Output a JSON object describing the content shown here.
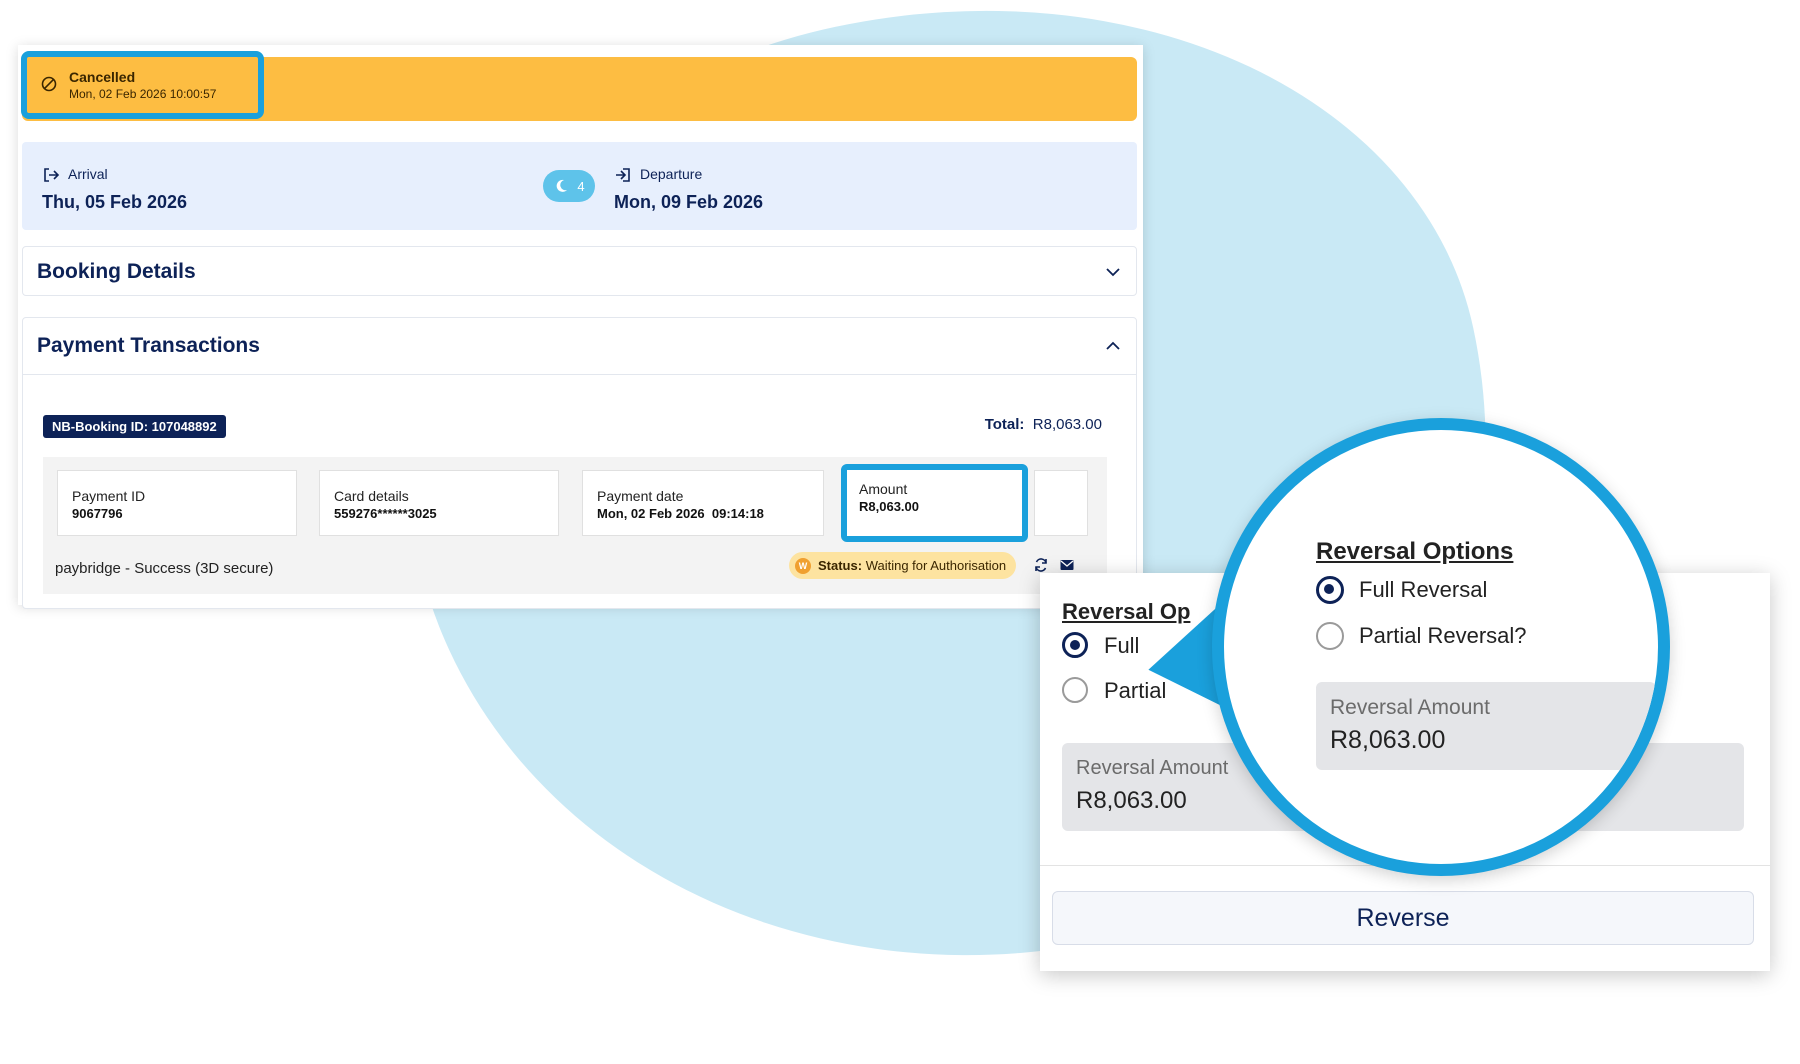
{
  "booking_status": {
    "label": "Cancelled",
    "timestamp": "Mon, 02 Feb 2026 10:00:57",
    "icon": "cancel-circle-icon"
  },
  "stay": {
    "arrival_label": "Arrival",
    "arrival_date": "Thu, 05 Feb 2026",
    "nights": "4",
    "departure_label": "Departure",
    "departure_date": "Mon, 09 Feb 2026"
  },
  "sections": {
    "booking_details": "Booking Details",
    "payment_transactions": "Payment Transactions"
  },
  "payment": {
    "booking_id_badge": "NB-Booking ID: 107048892",
    "total_label": "Total:",
    "total_value": "R8,063.00",
    "fields": [
      {
        "label": "Payment ID",
        "value": "9067796"
      },
      {
        "label": "Card details",
        "value": "559276******3025"
      },
      {
        "label": "Payment date",
        "value": "Mon, 02 Feb 2026  09:14:18"
      },
      {
        "label": "Amount",
        "value": "R8,063.00"
      }
    ],
    "gateway": "paybridge - Success (3D secure)",
    "status_initial": "W",
    "status_label": "Status:",
    "status_value": "Waiting for Authorisation"
  },
  "reversal": {
    "title": "Reversal Options",
    "title_truncated": "Reversal Op",
    "full_label": "Full Reversal",
    "full_truncated": "Full",
    "partial_label": "Partial Reversal?",
    "partial_truncated": "Partial",
    "amount_label": "Reversal Amount",
    "amount_value": "R8,063.00",
    "reverse_button": "Reverse"
  },
  "colors": {
    "brand_navy": "#0d2257",
    "banner_amber": "#fdbd42",
    "highlight_blue": "#1aa0dc",
    "blob_light_blue": "#c9e9f5"
  }
}
